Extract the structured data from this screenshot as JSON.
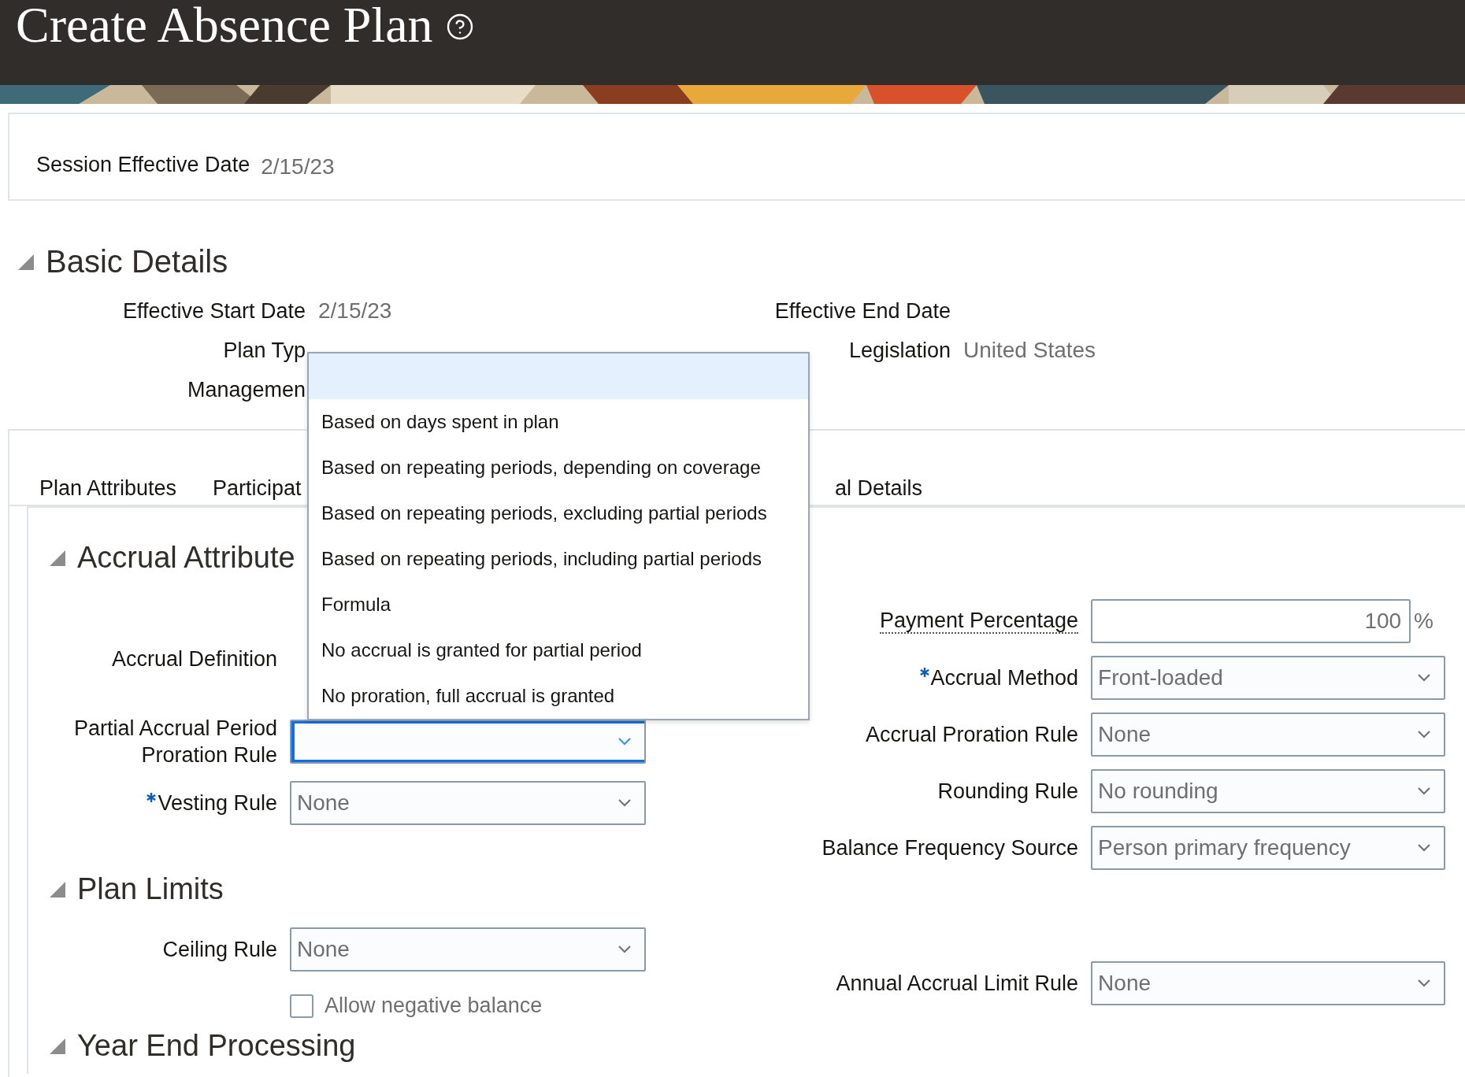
{
  "header": {
    "title": "Create Absence Plan"
  },
  "session": {
    "label": "Session Effective Date",
    "value": "2/15/23"
  },
  "basic_details": {
    "heading": "Basic Details",
    "expanded": true,
    "left": [
      {
        "label": "Effective Start Date",
        "value": "2/15/23"
      },
      {
        "label": "Plan Typ"
      },
      {
        "label": "Managemen"
      }
    ],
    "right": [
      {
        "label": "Effective End Date"
      },
      {
        "label": "Legislation",
        "value": "United States"
      }
    ]
  },
  "tabs": [
    {
      "label": "Plan Attributes"
    },
    {
      "label": "Participat"
    },
    {
      "label": "al Details"
    }
  ],
  "left_sections": [
    {
      "heading": "Accrual Attribute",
      "expanded": true,
      "fields": [
        {
          "kind": "label",
          "label": "Accrual Definition"
        },
        {
          "kind": "select",
          "label": "Partial Accrual Period Proration Rule",
          "required": false,
          "focused": true
        },
        {
          "kind": "select",
          "label": "Vesting Rule",
          "required": true,
          "focused": false,
          "value": "None"
        }
      ]
    },
    {
      "heading": "Plan Limits",
      "expanded": true,
      "fields": [
        {
          "kind": "select",
          "label": "Ceiling Rule",
          "required": false,
          "focused": false,
          "value": "None"
        },
        {
          "kind": "checkbox",
          "label": "Allow negative balance",
          "checked": false
        }
      ]
    },
    {
      "heading": "Year End Processing",
      "expanded": true
    }
  ],
  "right_fields": [
    {
      "kind": "number",
      "label": "Payment Percentage",
      "help": true,
      "value": "100",
      "suffix": "%"
    },
    {
      "kind": "select",
      "label": "Accrual Method",
      "required": true,
      "focused": false,
      "value": "Front-loaded"
    },
    {
      "kind": "select",
      "label": "Accrual Proration Rule",
      "required": false,
      "focused": false,
      "value": "None"
    },
    {
      "kind": "select",
      "label": "Rounding Rule",
      "required": false,
      "focused": false,
      "value": "No rounding"
    },
    {
      "kind": "select",
      "label": "Balance Frequency Source",
      "required": false,
      "focused": false,
      "value": "Person primary frequency"
    },
    {
      "kind": "gap"
    },
    {
      "kind": "select",
      "label": "Annual Accrual Limit Rule",
      "required": false,
      "focused": false,
      "value": "None"
    }
  ],
  "dropdown": {
    "options": [
      {
        "selected": true
      },
      {
        "label": "Based on days spent in plan",
        "selected": false
      },
      {
        "label": "Based on repeating periods, depending on coverage",
        "selected": false
      },
      {
        "label": "Based on repeating periods, excluding partial periods",
        "selected": false
      },
      {
        "label": "Based on repeating periods, including partial periods",
        "selected": false
      },
      {
        "label": "Formula",
        "selected": false
      },
      {
        "label": "No accrual is granted for partial period",
        "selected": false
      },
      {
        "label": "No proration, full accrual is granted",
        "selected": false
      }
    ]
  }
}
